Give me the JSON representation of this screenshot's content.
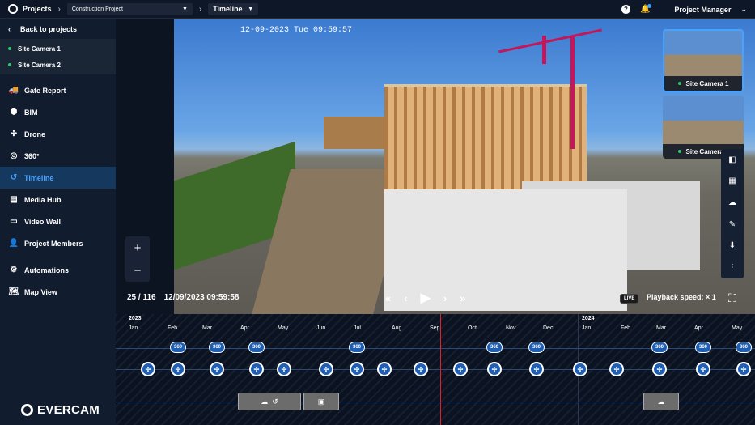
{
  "topbar": {
    "projects_label": "Projects",
    "project_select": "Construction Project",
    "view_select": "Timeline",
    "user": "Project Manager"
  },
  "sidebar": {
    "back": "Back to projects",
    "cameras": [
      "Site Camera 1",
      "Site Camera 2"
    ],
    "items": [
      {
        "label": "Gate Report",
        "icon": "truck-icon"
      },
      {
        "label": "BIM",
        "icon": "bim-icon"
      },
      {
        "label": "Drone",
        "icon": "drone-icon"
      },
      {
        "label": "360°",
        "icon": "360-icon"
      },
      {
        "label": "Timeline",
        "icon": "history-icon",
        "active": true
      },
      {
        "label": "Media Hub",
        "icon": "archive-icon"
      },
      {
        "label": "Video Wall",
        "icon": "monitor-icon"
      },
      {
        "label": "Project Members",
        "icon": "add-person-icon"
      },
      {
        "label": "Automations",
        "icon": "robot-icon"
      },
      {
        "label": "Map View",
        "icon": "map-icon"
      }
    ],
    "brand": "EVERCAM"
  },
  "viewer": {
    "timestamp": "12-09-2023 Tue 09:59:57",
    "counter": "25 / 116",
    "datetime": "12/09/2023 09:59:58",
    "live": "LIVE",
    "speed": "Playback speed: × 1",
    "thumbnails": [
      "Site Camera 1",
      "Site Camera 2"
    ]
  },
  "timeline": {
    "years": [
      "2023",
      "2024"
    ],
    "months_2023": [
      "Jan",
      "Feb",
      "Mar",
      "Apr",
      "May",
      "Jun",
      "Jul",
      "Aug",
      "Sep",
      "Oct",
      "Nov",
      "Dec"
    ],
    "months_2024": [
      "Jan",
      "Feb",
      "Mar",
      "Apr",
      "May"
    ]
  }
}
